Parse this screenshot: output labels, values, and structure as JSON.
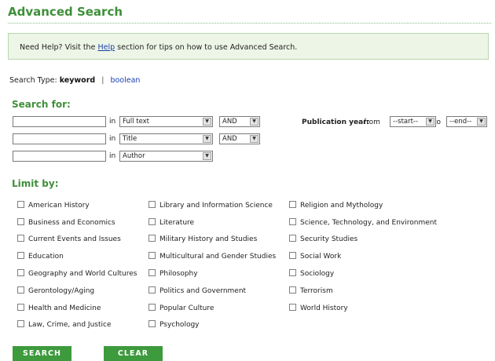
{
  "page": {
    "title": "Advanced Search"
  },
  "help": {
    "prefix": "Need Help? Visit the ",
    "link": "Help",
    "suffix": " section for tips on how to use Advanced Search."
  },
  "search_type": {
    "label": "Search Type: ",
    "options": [
      "keyword",
      "boolean"
    ],
    "separator": "|",
    "selected": "keyword"
  },
  "search_for": {
    "heading": "Search for:",
    "in_label": "in",
    "rows": [
      {
        "value": "",
        "field": "Full text",
        "operator": "AND"
      },
      {
        "value": "",
        "field": "Title",
        "operator": "AND"
      },
      {
        "value": "",
        "field": "Author",
        "operator": ""
      }
    ]
  },
  "publication_year": {
    "label": "Publication year:",
    "from_label": "from",
    "start": "--start--",
    "to_label": "to",
    "end": "--end--"
  },
  "limit_by": {
    "heading": "Limit by:",
    "columns": [
      [
        "American History",
        "Business and Economics",
        "Current Events and Issues",
        "Education",
        "Geography and World Cultures",
        "Gerontology/Aging",
        "Health and Medicine",
        "Law, Crime, and Justice"
      ],
      [
        "Library and Information Science",
        "Literature",
        "Military History and Studies",
        "Multicultural and Gender Studies",
        "Philosophy",
        "Politics and Government",
        "Popular Culture",
        "Psychology"
      ],
      [
        "Religion and Mythology",
        "Science, Technology, and Environment",
        "Security Studies",
        "Social Work",
        "Sociology",
        "Terrorism",
        "World History"
      ]
    ]
  },
  "buttons": {
    "search": "SEARCH",
    "clear": "CLEAR"
  },
  "colors": {
    "accent_green": "#3f8f3a",
    "button_green": "#3d9a3d",
    "help_bg": "#edf5e6",
    "link_blue": "#1a3fb0"
  },
  "icons": {
    "dropdown": "dropdown-arrow-icon"
  }
}
